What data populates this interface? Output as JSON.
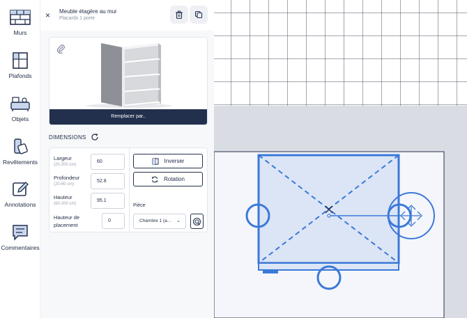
{
  "sidebar": {
    "items": [
      {
        "label": "Murs",
        "icon": "wall-icon"
      },
      {
        "label": "Plafonds",
        "icon": "ceiling-icon"
      },
      {
        "label": "Objets",
        "icon": "objects-icon"
      },
      {
        "label": "Revêtements",
        "icon": "coatings-icon"
      },
      {
        "label": "Annotations",
        "icon": "annotation-icon"
      },
      {
        "label": "Commentaires",
        "icon": "comment-icon"
      }
    ]
  },
  "panel": {
    "title": "Meuble étagère au mur",
    "subtitle": "Placards 1 porte",
    "replace_label": "Remplacer par..",
    "dimensions_title": "DIMENSIONS",
    "fields": {
      "largeur": {
        "label": "Largeur",
        "hint": "(20-200 cm)",
        "value": "60"
      },
      "profondeur": {
        "label": "Profondeur",
        "hint": "(20-80 cm)",
        "value": "52.8"
      },
      "hauteur": {
        "label": "Hauteur",
        "hint": "(60-200 cm)",
        "value": "95.1"
      },
      "placement": {
        "label_line1": "Hauteur de",
        "label_line2": "placement",
        "value": "0"
      }
    },
    "actions": {
      "inverser": "Inverser",
      "rotation": "Rotation"
    },
    "piece": {
      "label": "Pièce",
      "selected": "Chambre 1 (a..."
    }
  },
  "colors": {
    "accent": "#3b78d8",
    "dark": "#23304d",
    "floor": "#f4f6fb",
    "wall_band": "#d9dce2"
  }
}
